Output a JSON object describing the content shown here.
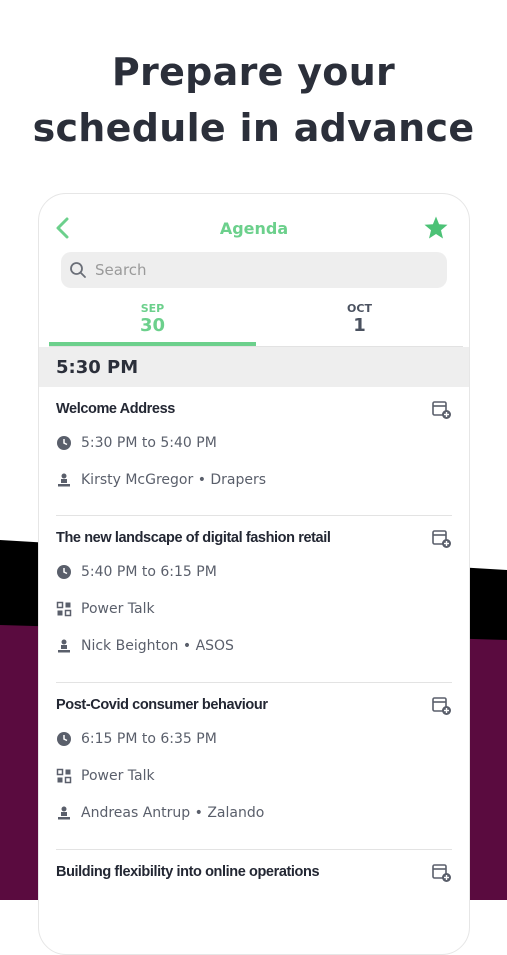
{
  "headline": {
    "line1": "Prepare your",
    "line2": "schedule in advance"
  },
  "nav": {
    "title": "Agenda",
    "back_icon": "chevron-left-icon",
    "star_icon": "star-icon"
  },
  "search": {
    "placeholder": "Search"
  },
  "dates": [
    {
      "month": "SEP",
      "day": "30",
      "active": true
    },
    {
      "month": "OCT",
      "day": "1",
      "active": false
    }
  ],
  "time_header": "5:30 PM",
  "sessions": [
    {
      "title": "Welcome Address",
      "time": "5:30 PM to 5:40 PM",
      "speaker": "Kirsty McGregor • Drapers"
    },
    {
      "title": "The new landscape of digital fashion retail",
      "time": "5:40 PM to 6:15 PM",
      "format": "Power Talk",
      "speaker": "Nick Beighton • ASOS"
    },
    {
      "title": "Post-Covid consumer behaviour",
      "time": "6:15 PM to 6:35 PM",
      "format": "Power Talk",
      "speaker": "Andreas Antrup • Zalando"
    },
    {
      "title": "Building flexibility into online operations"
    }
  ],
  "colors": {
    "accent": "#6cd08c",
    "dark_band": "#000000",
    "plum_band": "#5a0b3f",
    "headline": "#2b2f3a"
  }
}
